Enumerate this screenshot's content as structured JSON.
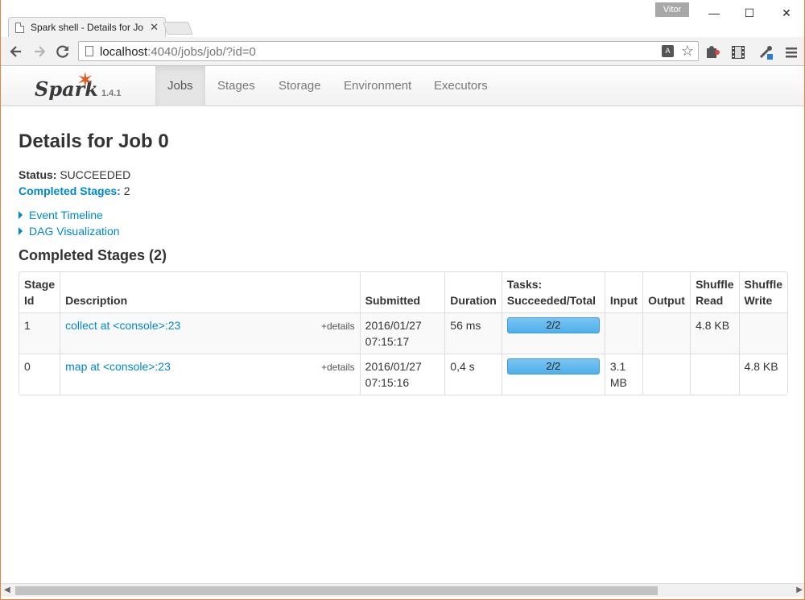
{
  "browser": {
    "tab_title": "Spark shell - Details for Jo",
    "tab_close": "✕",
    "user_name": "Vitor",
    "minimize": "—",
    "maximize": "☐",
    "close": "✕",
    "url_host": "localhost",
    "url_path": ":4040/jobs/job/?id=0",
    "back_icon": "arrow-left-icon",
    "forward_icon": "arrow-right-icon",
    "reload_icon": "reload-icon",
    "star": "☆",
    "translate": "A"
  },
  "spark": {
    "logo_text": "Spark",
    "version": "1.4.1",
    "nav": [
      {
        "label": "Jobs"
      },
      {
        "label": "Stages"
      },
      {
        "label": "Storage"
      },
      {
        "label": "Environment"
      },
      {
        "label": "Executors"
      }
    ]
  },
  "page": {
    "title": "Details for Job 0",
    "status_label": "Status:",
    "status_value": "SUCCEEDED",
    "completed_label": "Completed Stages:",
    "completed_value": "2",
    "event_timeline": "Event Timeline",
    "dag_visualization": "DAG Visualization",
    "section_title": "Completed Stages (2)"
  },
  "table": {
    "headers": {
      "stage_id": [
        "Stage",
        "Id"
      ],
      "description": "Description",
      "submitted": "Submitted",
      "duration": "Duration",
      "tasks": [
        "Tasks:",
        "Succeeded/Total"
      ],
      "input": "Input",
      "output": "Output",
      "shuffle_read": [
        "Shuffle",
        "Read"
      ],
      "shuffle_write": [
        "Shuffle",
        "Write"
      ]
    },
    "rows": [
      {
        "stage_id": "1",
        "description": "collect at <console>:23",
        "details": "+details",
        "submitted_date": "2016/01/27",
        "submitted_time": "07:15:17",
        "duration": "56 ms",
        "tasks": "2/2",
        "tasks_fraction": 1.0,
        "input_line1": "",
        "input_line2": "",
        "output": "",
        "shuffle_read": "4.8 KB",
        "shuffle_write": ""
      },
      {
        "stage_id": "0",
        "description": "map at <console>:23",
        "details": "+details",
        "submitted_date": "2016/01/27",
        "submitted_time": "07:15:16",
        "duration": "0,4 s",
        "tasks": "2/2",
        "tasks_fraction": 1.0,
        "input_line1": "3.1",
        "input_line2": "MB",
        "output": "",
        "shuffle_read": "",
        "shuffle_write": "4.8 KB"
      }
    ]
  }
}
